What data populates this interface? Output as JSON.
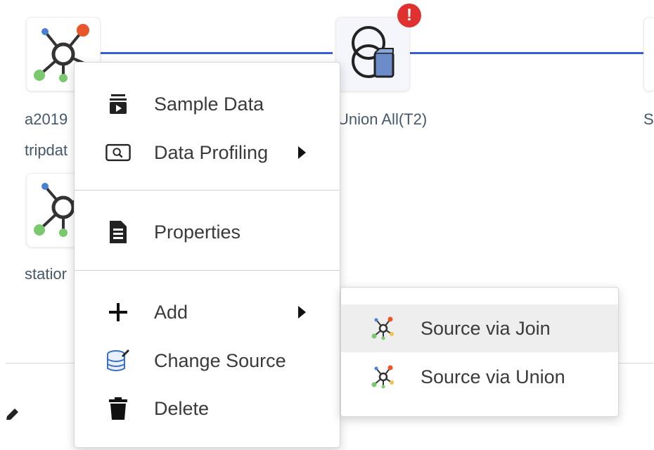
{
  "canvas": {
    "nodes": [
      {
        "label_line1": "a2019",
        "label_line2": "tripdat",
        "icon": "source-node-icon"
      },
      {
        "label_line1": "statior",
        "icon": "source-node-icon"
      },
      {
        "label_line1": "Union All(T2)",
        "icon": "union-node-icon",
        "badge": "!"
      },
      {
        "label_line1": "S",
        "icon": "source-node-icon"
      }
    ]
  },
  "context_menu": {
    "items": [
      {
        "label": "Sample Data",
        "icon": "sample-data-icon"
      },
      {
        "label": "Data Profiling",
        "icon": "data-profiling-icon",
        "has_submenu": true
      },
      {
        "label": "Properties",
        "icon": "properties-icon"
      },
      {
        "label": "Add",
        "icon": "plus-icon",
        "has_submenu": true
      },
      {
        "label": "Change Source",
        "icon": "change-source-icon"
      },
      {
        "label": "Delete",
        "icon": "trash-icon"
      }
    ]
  },
  "add_submenu": {
    "items": [
      {
        "label": "Source via Join",
        "icon": "source-join-icon",
        "highlighted": true
      },
      {
        "label": "Source via Union",
        "icon": "source-union-icon"
      }
    ]
  },
  "colors": {
    "connector": "#3b5bdb",
    "alert": "#e03131",
    "node_orange": "#e8572a",
    "node_blue": "#4a7fd4",
    "node_green": "#7bc96f",
    "node_yellow": "#f2c14e"
  }
}
